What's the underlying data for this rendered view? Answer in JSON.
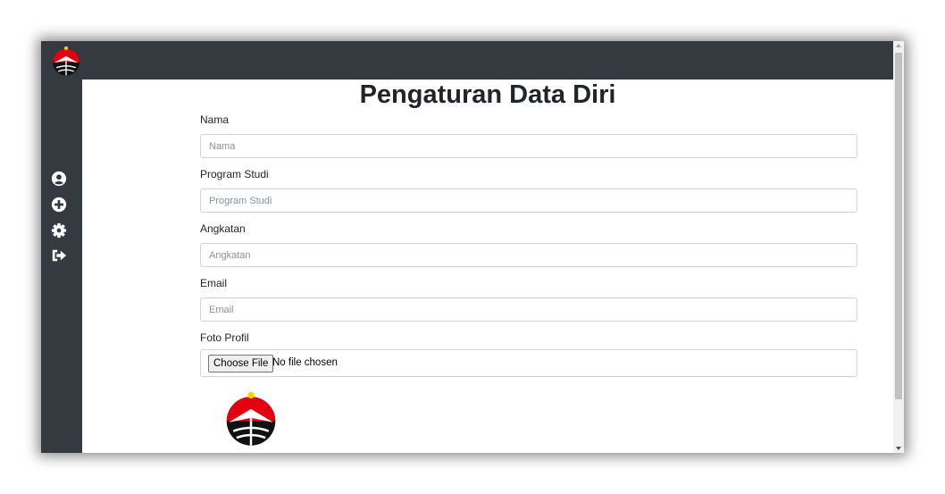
{
  "app": {
    "logo_icon": "upi-logo-icon"
  },
  "sidebar": {
    "items": [
      {
        "icon": "user-circle-icon"
      },
      {
        "icon": "plus-circle-icon"
      },
      {
        "icon": "gear-icon"
      },
      {
        "icon": "sign-out-icon"
      }
    ]
  },
  "page": {
    "title": "Pengaturan Data Diri"
  },
  "form": {
    "nama": {
      "label": "Nama",
      "placeholder": "Nama",
      "value": ""
    },
    "program_studi": {
      "label": "Program Studi",
      "placeholder": "Program Studi",
      "value": ""
    },
    "angkatan": {
      "label": "Angkatan",
      "placeholder": "Angkatan",
      "value": ""
    },
    "email": {
      "label": "Email",
      "placeholder": "Email",
      "value": ""
    },
    "foto_profil": {
      "label": "Foto Profil",
      "button_label": "Choose File",
      "status": "No file chosen"
    }
  },
  "colors": {
    "nav_bg": "#343a40",
    "logo_red": "#e3000f",
    "logo_yellow": "#ffd400",
    "logo_black": "#111111"
  }
}
